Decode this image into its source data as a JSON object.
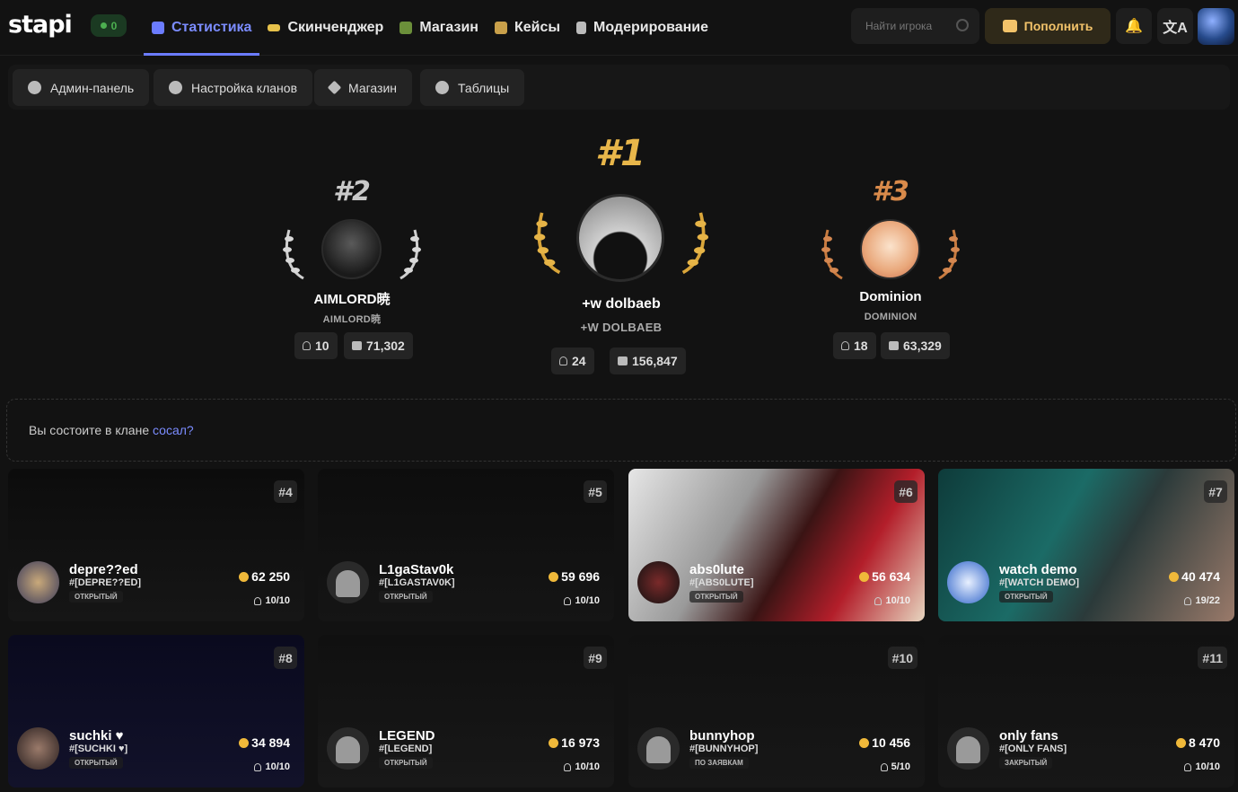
{
  "header": {
    "logo": "stapi",
    "online_count": "0",
    "nav": [
      {
        "label": "Статистика",
        "icon": "stats-icon",
        "active": true
      },
      {
        "label": "Скинченджер",
        "icon": "gun-icon"
      },
      {
        "label": "Магазин",
        "icon": "shop-icon"
      },
      {
        "label": "Кейсы",
        "icon": "case-icon"
      },
      {
        "label": "Модерирование",
        "icon": "document-icon"
      }
    ],
    "search_placeholder": "Найти игрока",
    "topup_label": "Пополнить"
  },
  "subnav": [
    {
      "label": "Админ-панель",
      "icon": "gear-icon"
    },
    {
      "label": "Настройка кланов",
      "icon": "users-icon"
    },
    {
      "label": "Магазин",
      "icon": "diamond-icon"
    },
    {
      "label": "Таблицы",
      "icon": "coins-icon"
    }
  ],
  "podium": {
    "first": {
      "rank": "#1",
      "name": "+w dolbaeb",
      "tag": "+W DOLBAEB",
      "members": "24",
      "money": "156,847"
    },
    "second": {
      "rank": "#2",
      "name": "AIMLORD暁",
      "tag": "AIMLORD暁",
      "members": "10",
      "money": "71,302"
    },
    "third": {
      "rank": "#3",
      "name": "Dominion",
      "tag": "DOMINION",
      "members": "18",
      "money": "63,329"
    }
  },
  "clan_prompt": {
    "text": "Вы состоите в клане ",
    "link": "сосал?"
  },
  "clans": [
    {
      "rank": "#4",
      "name": "depre??ed",
      "tag": "#[DEPRE??ED]",
      "status": "ОТКРЫТЫЙ",
      "money": "62 250",
      "members": "10/10"
    },
    {
      "rank": "#5",
      "name": "L1gaStav0k",
      "tag": "#[L1GASTAV0K]",
      "status": "ОТКРЫТЫЙ",
      "money": "59 696",
      "members": "10/10"
    },
    {
      "rank": "#6",
      "name": "abs0lute",
      "tag": "#[ABS0LUTE]",
      "status": "ОТКРЫТЫЙ",
      "money": "56 634",
      "members": "10/10"
    },
    {
      "rank": "#7",
      "name": "watch demo",
      "tag": "#[WATCH DEMO]",
      "status": "ОТКРЫТЫЙ",
      "money": "40 474",
      "members": "19/22"
    },
    {
      "rank": "#8",
      "name": "suchki ♥",
      "tag": "#[SUCHKI ♥]",
      "status": "ОТКРЫТЫЙ",
      "money": "34 894",
      "members": "10/10"
    },
    {
      "rank": "#9",
      "name": "LEGEND",
      "tag": "#[LEGEND]",
      "status": "ОТКРЫТЫЙ",
      "money": "16 973",
      "members": "10/10"
    },
    {
      "rank": "#10",
      "name": "bunnyhop",
      "tag": "#[BUNNYHOP]",
      "status": "ПО ЗАЯВКАМ",
      "money": "10 456",
      "members": "5/10"
    },
    {
      "rank": "#11",
      "name": "only fans",
      "tag": "#[ONLY FANS]",
      "status": "ЗАКРЫТЫЙ",
      "money": "8 470",
      "members": "10/10"
    }
  ]
}
